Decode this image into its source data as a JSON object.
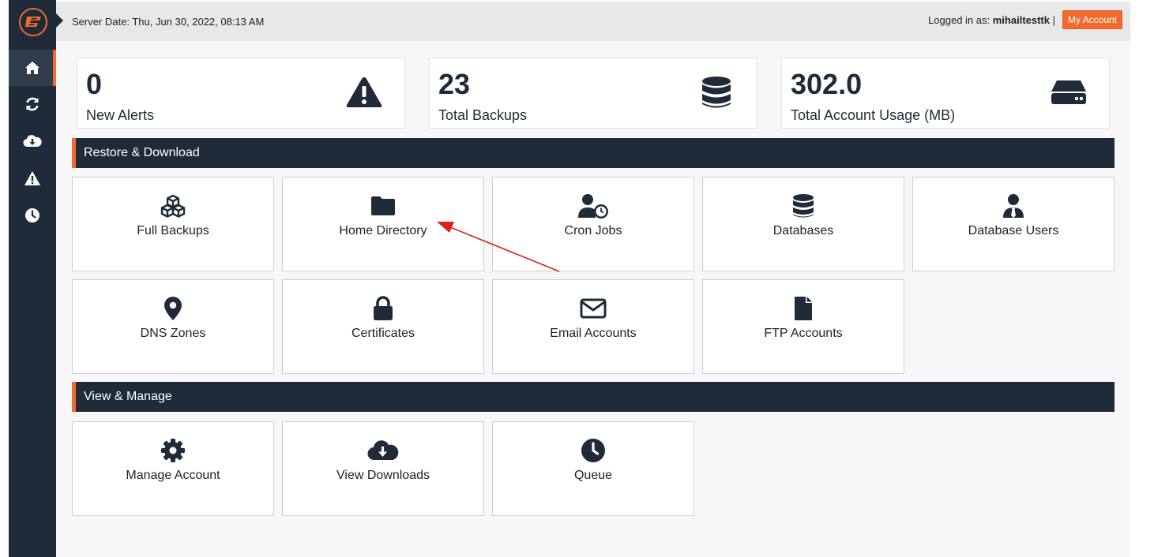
{
  "header": {
    "server_date": "Server Date: Thu, Jun 30, 2022, 08:13 AM",
    "logged_in_prefix": "Logged in as: ",
    "username": "mihailtesttk",
    "separator": " |",
    "my_account_label": "My Account"
  },
  "sidebar": {
    "items": [
      {
        "icon": "home-icon"
      },
      {
        "icon": "sync-icon"
      },
      {
        "icon": "cloud-download-icon"
      },
      {
        "icon": "alert-icon"
      },
      {
        "icon": "clock-icon"
      }
    ]
  },
  "stats": [
    {
      "value": "0",
      "label": "New Alerts",
      "icon": "warning-icon"
    },
    {
      "value": "23",
      "label": "Total Backups",
      "icon": "database-icon"
    },
    {
      "value": "302.0",
      "label": "Total Account Usage (MB)",
      "icon": "hard-drive-icon"
    }
  ],
  "sections": {
    "restore": {
      "title": "Restore & Download",
      "tiles": [
        {
          "label": "Full Backups",
          "icon": "cubes-icon"
        },
        {
          "label": "Home Directory",
          "icon": "folder-icon"
        },
        {
          "label": "Cron Jobs",
          "icon": "user-clock-icon"
        },
        {
          "label": "Databases",
          "icon": "database-icon"
        },
        {
          "label": "Database Users",
          "icon": "user-tie-icon"
        },
        {
          "label": "DNS Zones",
          "icon": "map-marker-icon"
        },
        {
          "label": "Certificates",
          "icon": "lock-icon"
        },
        {
          "label": "Email Accounts",
          "icon": "envelope-icon"
        },
        {
          "label": "FTP Accounts",
          "icon": "file-icon"
        }
      ]
    },
    "manage": {
      "title": "View & Manage",
      "tiles": [
        {
          "label": "Manage Account",
          "icon": "gear-icon"
        },
        {
          "label": "View Downloads",
          "icon": "cloud-download-icon"
        },
        {
          "label": "Queue",
          "icon": "clock-icon"
        }
      ]
    }
  },
  "colors": {
    "sidebar": "#1f2b38",
    "accent": "#f26a2e",
    "annotation_arrow": "#e02020"
  }
}
